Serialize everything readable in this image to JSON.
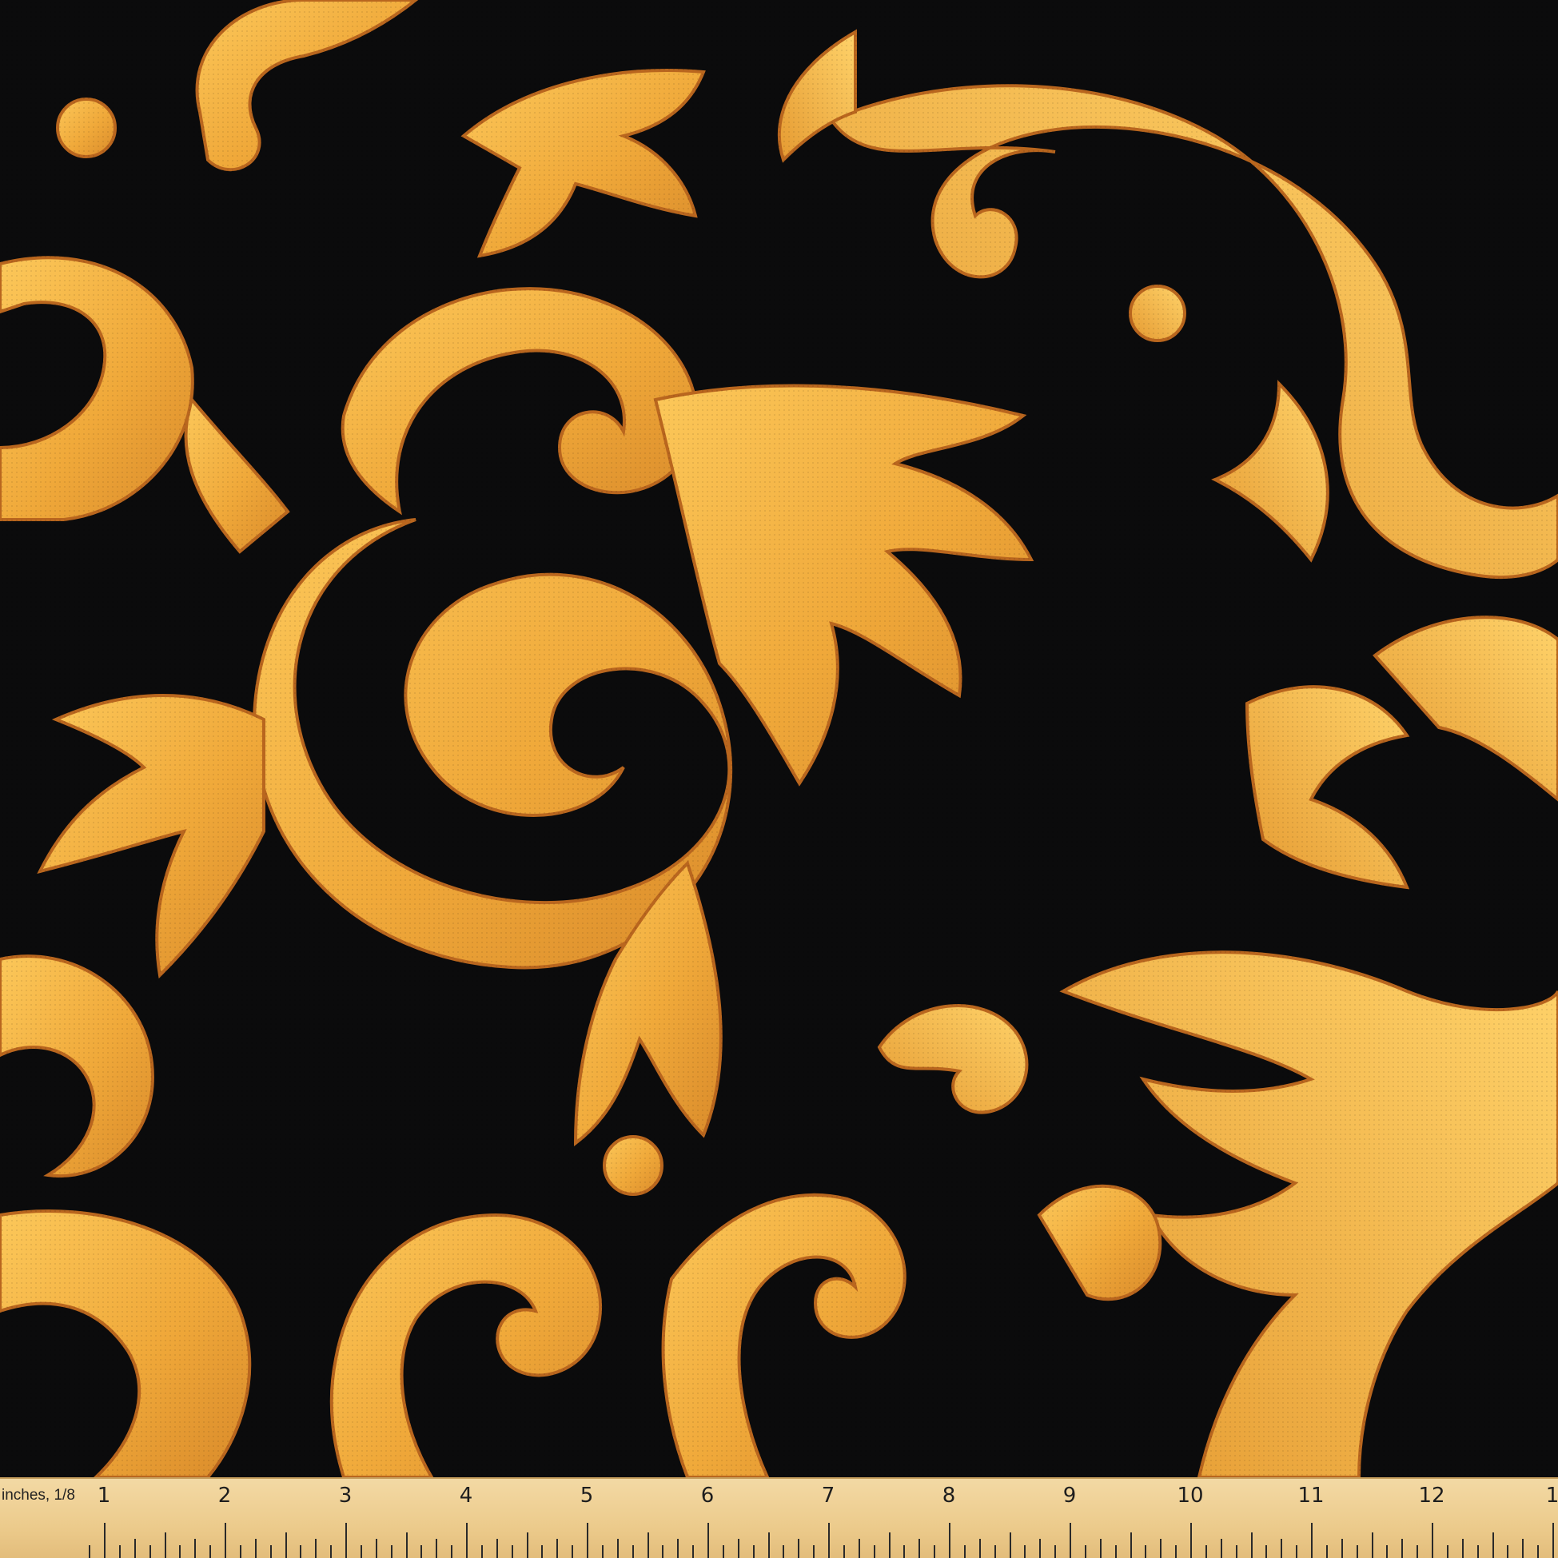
{
  "scene": {
    "subject": "gold-baroque-scroll-fabric",
    "background_color": "#0b0b0c",
    "ornament_color": "#f0a93a",
    "ornament_highlight": "#fcc85a",
    "ornament_shadow": "#b9661e"
  },
  "ruler": {
    "unit_label": "inches, 1/8",
    "numbers": [
      "1",
      "2",
      "3",
      "4",
      "5",
      "6",
      "7",
      "8",
      "9",
      "10",
      "11",
      "12",
      "1"
    ]
  }
}
